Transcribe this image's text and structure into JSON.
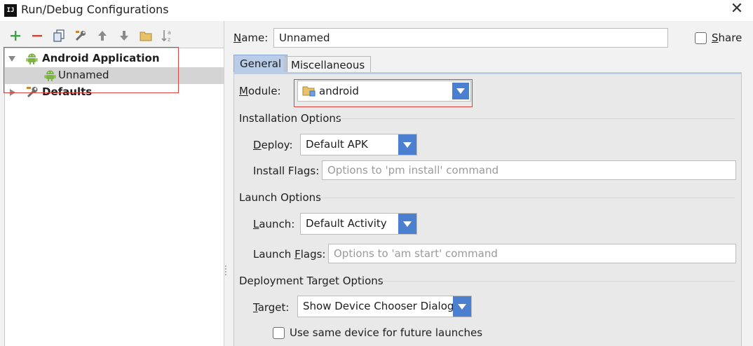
{
  "window": {
    "title": "Run/Debug Configurations",
    "app_icon_text": "IJ"
  },
  "toolbar": {
    "icons": [
      "add-icon",
      "remove-icon",
      "copy-icon",
      "edit-defaults-icon",
      "move-up-icon",
      "move-down-icon",
      "folder-icon",
      "sort-icon"
    ]
  },
  "tree": {
    "items": [
      {
        "label": "Android Application",
        "icon": "android-icon",
        "expanded": true,
        "bold": true
      },
      {
        "label": "Unnamed",
        "icon": "android-icon",
        "selected": true
      },
      {
        "label": "Defaults",
        "icon": "wrench-icon",
        "expanded": false,
        "bold": true
      }
    ]
  },
  "form": {
    "name_label": "Name:",
    "name_value": "Unnamed",
    "share_label": "Share",
    "share_checked": false
  },
  "tabs": [
    {
      "label": "General",
      "active": true
    },
    {
      "label": "Miscellaneous",
      "active": false
    }
  ],
  "general": {
    "module_label": "Module:",
    "module_value": "android",
    "installation_title": "Installation Options",
    "deploy_label": "Deploy:",
    "deploy_value": "Default APK",
    "install_flags_label": "Install Flags:",
    "install_flags_placeholder": "Options to 'pm install' command",
    "launch_title": "Launch Options",
    "launch_label": "Launch:",
    "launch_value": "Default Activity",
    "launch_flags_label": "Launch Flags:",
    "launch_flags_placeholder": "Options to 'am start' command",
    "deployment_title": "Deployment Target Options",
    "target_label": "Target:",
    "target_value": "Show Device Chooser Dialog",
    "same_device_label": "Use same device for future launches",
    "same_device_checked": false
  },
  "colors": {
    "accent": "#4b7fd0",
    "android_green": "#7cb342",
    "highlight_red": "#e04040",
    "tab_active": "#b9cde8"
  }
}
